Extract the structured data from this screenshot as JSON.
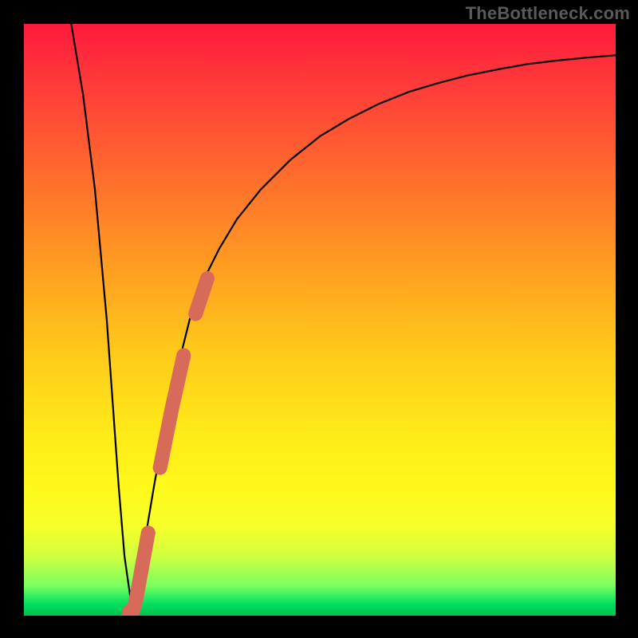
{
  "watermark": "TheBottleneck.com",
  "chart_data": {
    "type": "line",
    "title": "",
    "xlabel": "",
    "ylabel": "",
    "xlim": [
      0,
      100
    ],
    "ylim": [
      0,
      100
    ],
    "grid": false,
    "legend": false,
    "series": [
      {
        "name": "bottleneck-curve",
        "color": "#000000",
        "x": [
          8,
          10,
          12,
          14,
          15,
          16,
          17,
          18,
          18.5,
          19,
          20,
          22,
          24,
          26,
          28,
          30,
          33,
          36,
          40,
          45,
          50,
          55,
          60,
          65,
          70,
          75,
          80,
          85,
          90,
          95,
          100
        ],
        "y": [
          100,
          88,
          72,
          50,
          36,
          22,
          10,
          3,
          1,
          3,
          10,
          22,
          33,
          42,
          50,
          56,
          62,
          67,
          72,
          77,
          81,
          84,
          86.5,
          88.5,
          90,
          91.3,
          92.3,
          93.2,
          93.8,
          94.3,
          94.7
        ]
      },
      {
        "name": "highlight-segment",
        "color": "#d86a5a",
        "x": [
          18.5,
          19,
          21,
          23,
          25,
          27,
          29,
          31
        ],
        "y": [
          1,
          3,
          14,
          25,
          35,
          44,
          51,
          57
        ]
      }
    ],
    "colors": {
      "background_gradient_top": "#ff1a3c",
      "background_gradient_mid": "#fff81a",
      "background_gradient_bottom": "#00c050",
      "frame": "#000000"
    }
  }
}
